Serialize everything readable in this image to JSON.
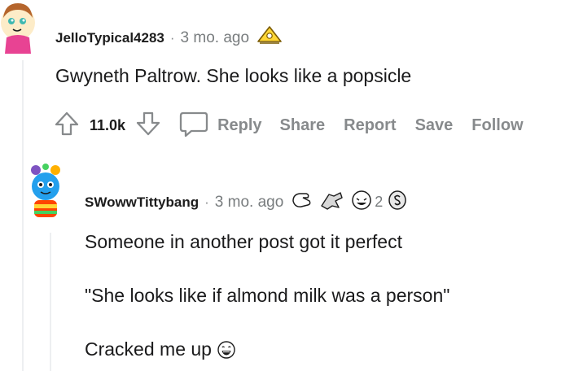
{
  "comment": {
    "username": "JelloTypical4283",
    "separator": "·",
    "time": "3 mo. ago",
    "body": "Gwyneth Paltrow. She looks like a popsicle",
    "votes": "11.0k",
    "actions": [
      "Reply",
      "Share",
      "Report",
      "Save",
      "Follow"
    ]
  },
  "reply": {
    "username": "SWowwTittybang",
    "separator": "·",
    "time": "3 mo. ago",
    "award_count": "2",
    "lines": [
      "Someone in another post got it perfect",
      "\"She looks like if almond milk was a person\"",
      "Cracked me up"
    ]
  },
  "colors": {
    "thread": "#edeff1",
    "muted": "#878a8c",
    "text": "#1a1a1b"
  },
  "icons": [
    "upvote-icon",
    "downvote-icon",
    "comment-icon",
    "award-icon",
    "grin-emoji-icon"
  ]
}
